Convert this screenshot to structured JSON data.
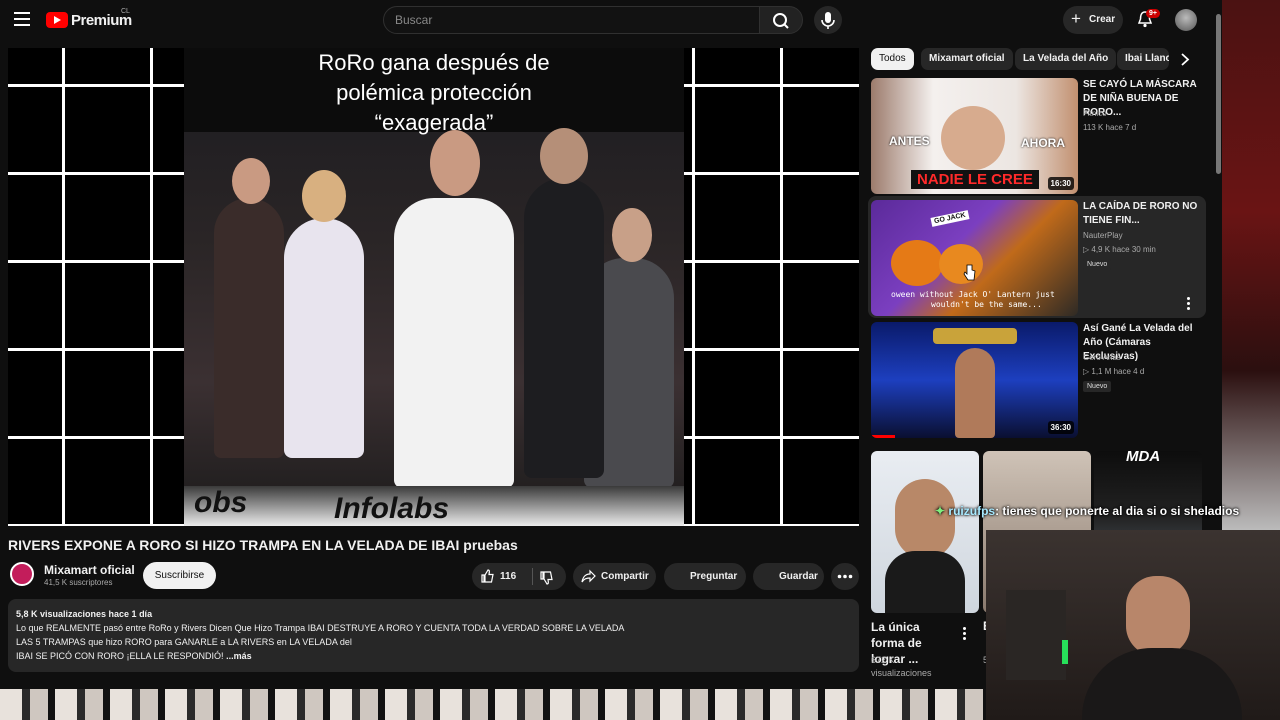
{
  "topbar": {
    "brand": "Premium",
    "country": "CL",
    "search_placeholder": "Buscar",
    "create_label": "Crear",
    "notification_count": "9+"
  },
  "player": {
    "caption": [
      "RoRo gana después de",
      "polémica protección",
      "“exagerada”"
    ],
    "watermark": [
      "obs",
      "Infolabs"
    ]
  },
  "video": {
    "title": "RIVERS EXPONE A RORO SI HIZO TRAMPA EN LA VELADA DE IBAI pruebas",
    "channel_name": "Mixamart oficial",
    "subscribers": "41,5 K suscriptores",
    "subscribe_label": "Suscribirse",
    "likes": "116",
    "share_label": "Compartir",
    "ask_label": "Preguntar",
    "save_label": "Guardar"
  },
  "description": {
    "stats": "5,8 K visualizaciones  hace 1 día",
    "lines": [
      "Lo que REALMENTE pasó entre RoRo y Rivers Dicen Que Hizo Trampa IBAI DESTRUYE A RORO Y CUENTA TODA LA VERDAD SOBRE LA VELADA",
      " LAS 5 TRAMPAS que hizo RORO para GANARLE a LA RIVERS en LA VELADA del",
      "IBAI SE PICÓ CON RORO ¡ELLA LE RESPONDIÓ!"
    ],
    "more": "...más"
  },
  "chips": [
    "Todos",
    "Mixamart oficial",
    "La Velada del Año",
    "Ibai Llano"
  ],
  "related": [
    {
      "title": "SE CAYÓ LA MÁSCARA DE NIÑA BUENA DE RORO...",
      "channel": "Fitnico",
      "stats": "113 K   hace 7 d",
      "duration": "16:30",
      "thumb_text": [
        "ANTES",
        "AHORA",
        "NADIE LE CREE"
      ],
      "badge": ""
    },
    {
      "title": "LA CAÍDA DE RORO NO TIENE FIN...",
      "channel": "NauterPlay",
      "stats": "▷ 4,9 K   hace 30 min",
      "duration": "",
      "thumb_text": [
        "GO JACK",
        "oween without Jack O' Lantern just",
        "wouldn't be the same..."
      ],
      "badge": "Nuevo"
    },
    {
      "title": "Así Gané La Velada del Año (Cámaras Exclusivas)",
      "channel": "Gero Arias",
      "stats": "▷ 1,1 M   hace 4 d",
      "duration": "36:30",
      "thumb_text": [],
      "badge": "Nuevo"
    }
  ],
  "shorts": [
    {
      "title": "La única forma de lograr ...",
      "views": "672 K",
      "views_label": "visualizaciones"
    },
    {
      "title": "E",
      "views": "5",
      "views_label": ""
    },
    {
      "title": "",
      "views": "",
      "views_label": "",
      "thumb_text": "MDA"
    }
  ],
  "chat": {
    "user": "ruizufps",
    "message": ": tienes que ponerte al dia si o si sheladios"
  },
  "colors": {
    "accent": "#ff0000",
    "background": "#0f0f0f",
    "surface": "#272727",
    "badge": "#cc0000"
  }
}
